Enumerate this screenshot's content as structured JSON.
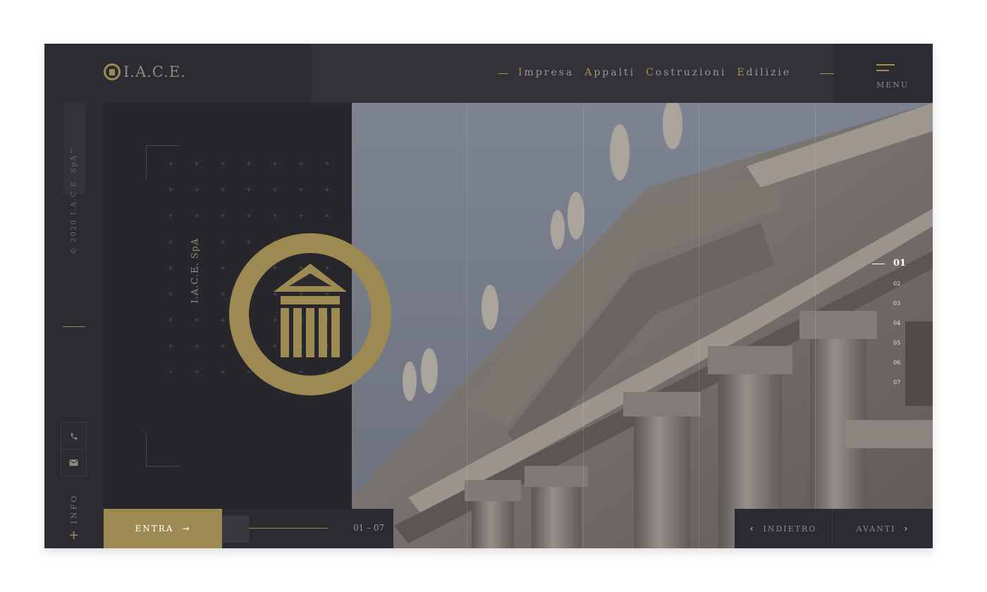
{
  "brand": {
    "logo_text": "I.A.C.E.",
    "tagline_parts": [
      {
        "initial": "I",
        "rest": "mpresa"
      },
      {
        "initial": "A",
        "rest": "ppalti"
      },
      {
        "initial": "C",
        "rest": "ostruzioni"
      },
      {
        "initial": "E",
        "rest": "dilizie"
      }
    ]
  },
  "header": {
    "menu_label": "MENU"
  },
  "sidebar": {
    "copyright": "© 2020 I.A.C.E. SpA™",
    "info_label": "INFO",
    "phone_icon": "phone-icon",
    "mail_icon": "mail-icon"
  },
  "panel": {
    "title": "I.A.C.E. SpA"
  },
  "slides": {
    "active": "01",
    "items": [
      "01",
      "02",
      "03",
      "04",
      "05",
      "06",
      "07"
    ]
  },
  "footer": {
    "enter_label": "ENTRA",
    "counter": "01 – 07",
    "prev_label": "INDIETRO",
    "next_label": "AVANTI"
  },
  "colors": {
    "accent_gold": "#9c8a52",
    "dark_bg": "#2c2b31",
    "panel_bg": "#27262b"
  }
}
